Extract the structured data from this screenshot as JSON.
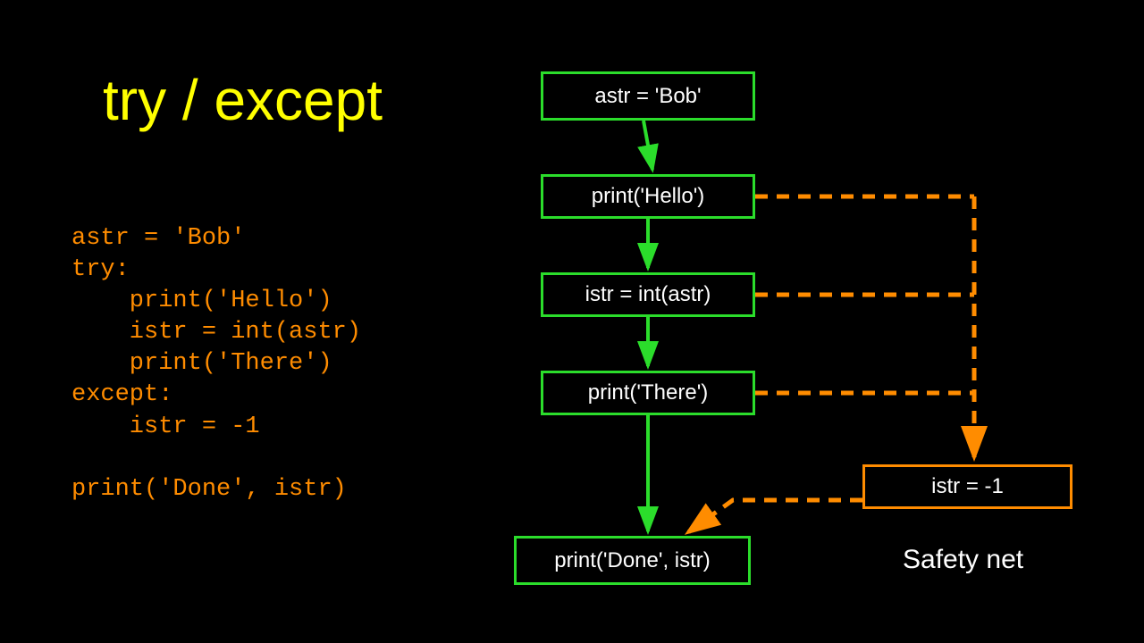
{
  "title": "try / except",
  "code_lines": "astr = 'Bob'\ntry:\n    print('Hello')\n    istr = int(astr)\n    print('There')\nexcept:\n    istr = -1\n\nprint('Done', istr)",
  "boxes": {
    "b1": "astr = 'Bob'",
    "b2": "print('Hello')",
    "b3": "istr = int(astr)",
    "b4": "print('There')",
    "b5": "print('Done', istr)",
    "b6": "istr = -1"
  },
  "labels": {
    "safety": "Safety net"
  },
  "colors": {
    "green": "#2bdd2b",
    "orange": "#ff8c00",
    "yellow": "#ffff00"
  }
}
